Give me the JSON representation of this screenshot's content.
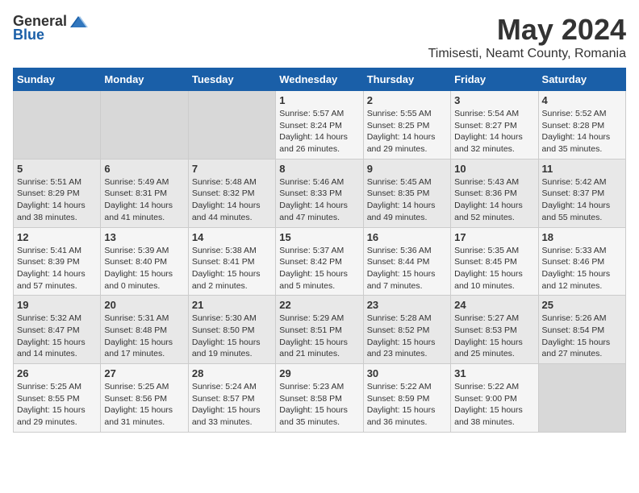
{
  "logo": {
    "general": "General",
    "blue": "Blue"
  },
  "title": "May 2024",
  "subtitle": "Timisesti, Neamt County, Romania",
  "weekdays": [
    "Sunday",
    "Monday",
    "Tuesday",
    "Wednesday",
    "Thursday",
    "Friday",
    "Saturday"
  ],
  "weeks": [
    [
      {
        "day": "",
        "info": ""
      },
      {
        "day": "",
        "info": ""
      },
      {
        "day": "",
        "info": ""
      },
      {
        "day": "1",
        "info": "Sunrise: 5:57 AM\nSunset: 8:24 PM\nDaylight: 14 hours and 26 minutes."
      },
      {
        "day": "2",
        "info": "Sunrise: 5:55 AM\nSunset: 8:25 PM\nDaylight: 14 hours and 29 minutes."
      },
      {
        "day": "3",
        "info": "Sunrise: 5:54 AM\nSunset: 8:27 PM\nDaylight: 14 hours and 32 minutes."
      },
      {
        "day": "4",
        "info": "Sunrise: 5:52 AM\nSunset: 8:28 PM\nDaylight: 14 hours and 35 minutes."
      }
    ],
    [
      {
        "day": "5",
        "info": "Sunrise: 5:51 AM\nSunset: 8:29 PM\nDaylight: 14 hours and 38 minutes."
      },
      {
        "day": "6",
        "info": "Sunrise: 5:49 AM\nSunset: 8:31 PM\nDaylight: 14 hours and 41 minutes."
      },
      {
        "day": "7",
        "info": "Sunrise: 5:48 AM\nSunset: 8:32 PM\nDaylight: 14 hours and 44 minutes."
      },
      {
        "day": "8",
        "info": "Sunrise: 5:46 AM\nSunset: 8:33 PM\nDaylight: 14 hours and 47 minutes."
      },
      {
        "day": "9",
        "info": "Sunrise: 5:45 AM\nSunset: 8:35 PM\nDaylight: 14 hours and 49 minutes."
      },
      {
        "day": "10",
        "info": "Sunrise: 5:43 AM\nSunset: 8:36 PM\nDaylight: 14 hours and 52 minutes."
      },
      {
        "day": "11",
        "info": "Sunrise: 5:42 AM\nSunset: 8:37 PM\nDaylight: 14 hours and 55 minutes."
      }
    ],
    [
      {
        "day": "12",
        "info": "Sunrise: 5:41 AM\nSunset: 8:39 PM\nDaylight: 14 hours and 57 minutes."
      },
      {
        "day": "13",
        "info": "Sunrise: 5:39 AM\nSunset: 8:40 PM\nDaylight: 15 hours and 0 minutes."
      },
      {
        "day": "14",
        "info": "Sunrise: 5:38 AM\nSunset: 8:41 PM\nDaylight: 15 hours and 2 minutes."
      },
      {
        "day": "15",
        "info": "Sunrise: 5:37 AM\nSunset: 8:42 PM\nDaylight: 15 hours and 5 minutes."
      },
      {
        "day": "16",
        "info": "Sunrise: 5:36 AM\nSunset: 8:44 PM\nDaylight: 15 hours and 7 minutes."
      },
      {
        "day": "17",
        "info": "Sunrise: 5:35 AM\nSunset: 8:45 PM\nDaylight: 15 hours and 10 minutes."
      },
      {
        "day": "18",
        "info": "Sunrise: 5:33 AM\nSunset: 8:46 PM\nDaylight: 15 hours and 12 minutes."
      }
    ],
    [
      {
        "day": "19",
        "info": "Sunrise: 5:32 AM\nSunset: 8:47 PM\nDaylight: 15 hours and 14 minutes."
      },
      {
        "day": "20",
        "info": "Sunrise: 5:31 AM\nSunset: 8:48 PM\nDaylight: 15 hours and 17 minutes."
      },
      {
        "day": "21",
        "info": "Sunrise: 5:30 AM\nSunset: 8:50 PM\nDaylight: 15 hours and 19 minutes."
      },
      {
        "day": "22",
        "info": "Sunrise: 5:29 AM\nSunset: 8:51 PM\nDaylight: 15 hours and 21 minutes."
      },
      {
        "day": "23",
        "info": "Sunrise: 5:28 AM\nSunset: 8:52 PM\nDaylight: 15 hours and 23 minutes."
      },
      {
        "day": "24",
        "info": "Sunrise: 5:27 AM\nSunset: 8:53 PM\nDaylight: 15 hours and 25 minutes."
      },
      {
        "day": "25",
        "info": "Sunrise: 5:26 AM\nSunset: 8:54 PM\nDaylight: 15 hours and 27 minutes."
      }
    ],
    [
      {
        "day": "26",
        "info": "Sunrise: 5:25 AM\nSunset: 8:55 PM\nDaylight: 15 hours and 29 minutes."
      },
      {
        "day": "27",
        "info": "Sunrise: 5:25 AM\nSunset: 8:56 PM\nDaylight: 15 hours and 31 minutes."
      },
      {
        "day": "28",
        "info": "Sunrise: 5:24 AM\nSunset: 8:57 PM\nDaylight: 15 hours and 33 minutes."
      },
      {
        "day": "29",
        "info": "Sunrise: 5:23 AM\nSunset: 8:58 PM\nDaylight: 15 hours and 35 minutes."
      },
      {
        "day": "30",
        "info": "Sunrise: 5:22 AM\nSunset: 8:59 PM\nDaylight: 15 hours and 36 minutes."
      },
      {
        "day": "31",
        "info": "Sunrise: 5:22 AM\nSunset: 9:00 PM\nDaylight: 15 hours and 38 minutes."
      },
      {
        "day": "",
        "info": ""
      }
    ]
  ]
}
